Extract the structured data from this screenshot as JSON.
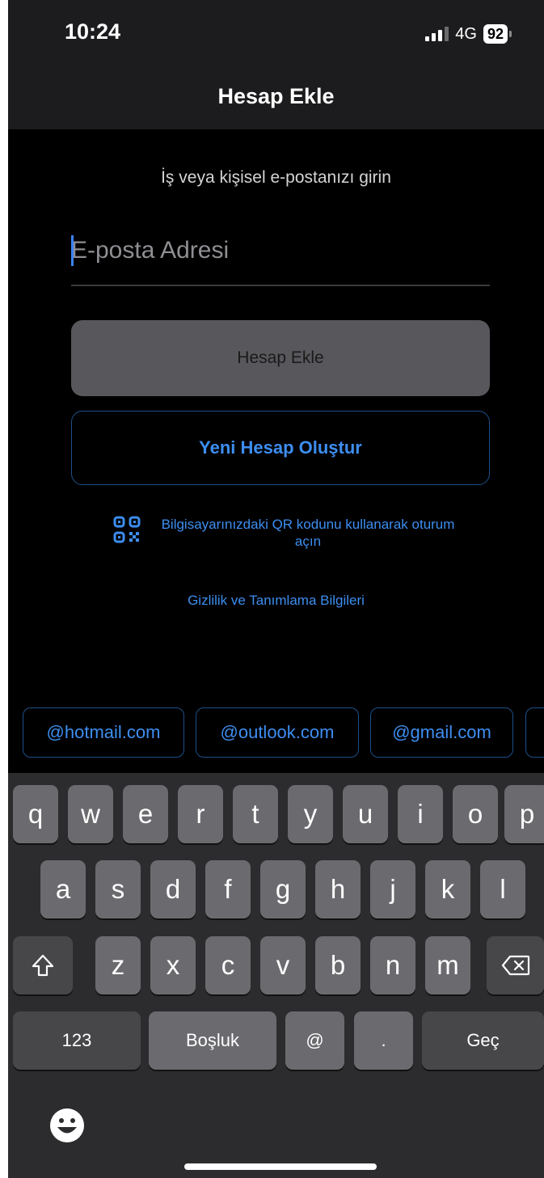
{
  "status_bar": {
    "time": "10:24",
    "network": "4G",
    "battery": "92"
  },
  "header": {
    "title": "Hesap Ekle"
  },
  "main": {
    "instruction": "İş veya kişisel e-postanızı girin",
    "email_placeholder": "E-posta Adresi",
    "add_account_button": "Hesap Ekle",
    "create_account_button": "Yeni Hesap Oluştur",
    "qr_text": "Bilgisayarınızdaki QR kodunu kullanarak oturum açın",
    "privacy_link": "Gizlilik ve Tanımlama Bilgileri"
  },
  "suggestions": [
    "@hotmail.com",
    "@outlook.com",
    "@gmail.com"
  ],
  "keyboard": {
    "row1": [
      "q",
      "w",
      "e",
      "r",
      "t",
      "y",
      "u",
      "i",
      "o",
      "p"
    ],
    "row2": [
      "a",
      "s",
      "d",
      "f",
      "g",
      "h",
      "j",
      "k",
      "l"
    ],
    "row3": [
      "z",
      "x",
      "c",
      "v",
      "b",
      "n",
      "m"
    ],
    "numbers": "123",
    "space": "Boşluk",
    "at": "@",
    "dot": ".",
    "go": "Geç"
  },
  "icons": [
    "signal-icon",
    "battery-icon",
    "qr-code-icon",
    "shift-icon",
    "backspace-icon",
    "emoji-icon"
  ],
  "colors": {
    "accent": "#3d8ef0",
    "background": "#000000",
    "keyboard": "#2c2c2e"
  }
}
